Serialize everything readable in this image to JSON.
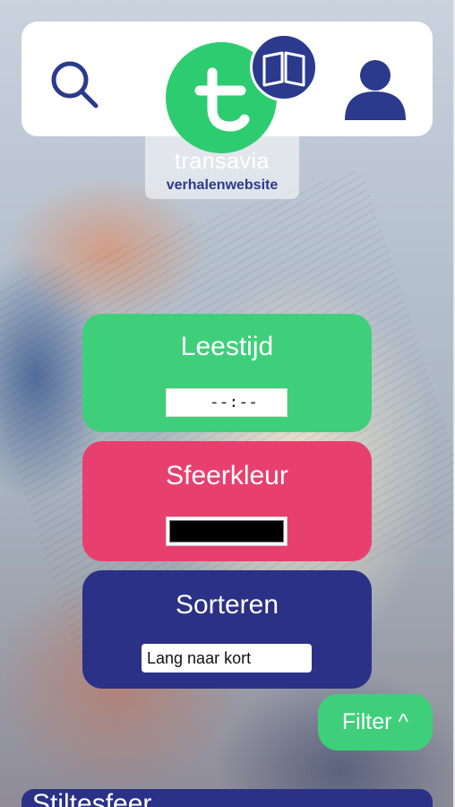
{
  "colors": {
    "brand_green": "#3fcf7a",
    "brand_navy": "#2b3187",
    "accent_pink": "#e8406e",
    "selected_mood_color": "#000000"
  },
  "header": {
    "search_icon": "search-icon",
    "user_icon": "user-icon",
    "logo": {
      "brand": "transavia",
      "subtitle": "verhalenwebsite",
      "badge_icon": "book-icon"
    }
  },
  "filters": {
    "reading_time": {
      "label": "Leestijd",
      "value": "--:--"
    },
    "mood_color": {
      "label": "Sfeerkleur",
      "value": "#000000"
    },
    "sort": {
      "label": "Sorteren",
      "selected": "Lang naar kort"
    }
  },
  "filter_toggle": {
    "label": "Filter ^"
  },
  "bottom_card": {
    "title": "Stiltesfeer"
  }
}
